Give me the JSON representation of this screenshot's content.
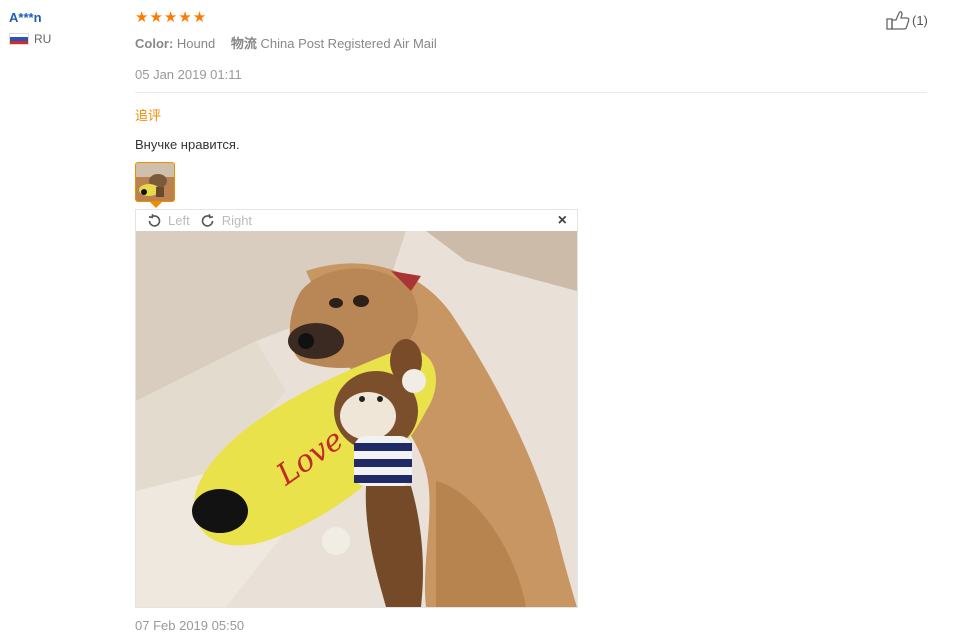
{
  "user": {
    "name": "A***n",
    "country": "RU"
  },
  "review": {
    "stars": "★★★★★",
    "color_key": "Color:",
    "color_value": "Hound",
    "shipping_key": "物流",
    "shipping_value": "China Post Registered Air Mail",
    "date": "05 Jan 2019 01:11",
    "likes": "(1)"
  },
  "followup": {
    "label": "追评",
    "text": "Внучке нравится.",
    "date": "07 Feb 2019 05:50"
  },
  "viewer": {
    "left_label": "Left",
    "right_label": "Right",
    "close_label": "×"
  },
  "colors": {
    "accent": "#f08c00",
    "star": "#ff7a00",
    "username": "#1a5fb4"
  }
}
